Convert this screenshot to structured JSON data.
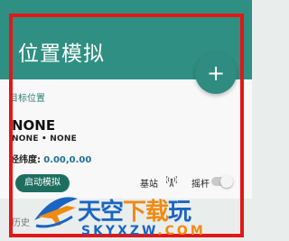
{
  "header": {
    "title": "位置模拟"
  },
  "fab": {
    "icon": "plus-icon",
    "symbol": "+"
  },
  "target": {
    "label": "目标位置",
    "name": "NONE",
    "sub": "NONE • NONE",
    "coords_label": "经纬度:",
    "coords_value": "0.00,0.00"
  },
  "controls": {
    "start_label": "启动模拟",
    "base_label": "基站",
    "base_icon": "antenna-icon",
    "stick_label": "摇杆",
    "stick_enabled": false
  },
  "history": {
    "label": "历史"
  },
  "watermark": {
    "brand_blue": "天空",
    "brand_orange": "下载",
    "brand_tail": "玩",
    "domain_blue": "SKYXZW",
    "domain_orange": ".COM"
  },
  "colors": {
    "header": "#2f8f82",
    "fab": "#2e8c80",
    "start_button": "#1e6e60",
    "frame": "#e01818",
    "watermark_blue": "#1a64c4",
    "watermark_orange": "#f08a12"
  }
}
